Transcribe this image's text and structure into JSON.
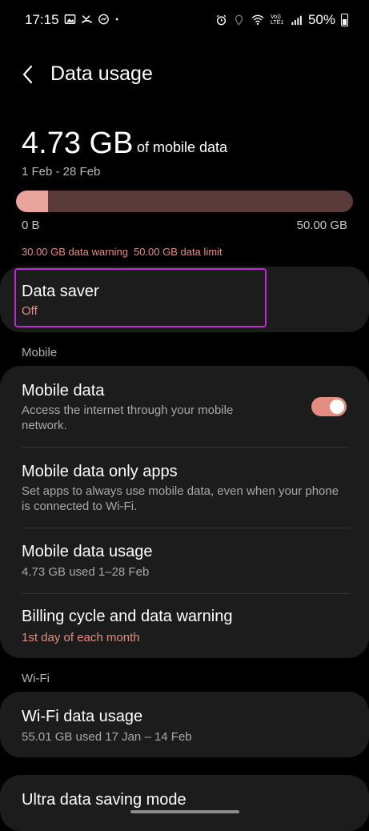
{
  "status_bar": {
    "time": "17:15",
    "left_icons": [
      "gallery-icon",
      "missed-call-icon",
      "messenger-icon",
      "dot-icon"
    ],
    "right_icons": [
      "alarm-icon",
      "location-icon",
      "wifi-icon",
      "volte-icon",
      "signal-icon"
    ],
    "volte_label": "Vo)) LTE1",
    "battery": "50%"
  },
  "header": {
    "title": "Data usage",
    "back_icon": "back-chevron-icon"
  },
  "usage": {
    "amount": "4.73 GB",
    "unit_label": "of mobile data",
    "period": "1 Feb - 28 Feb",
    "bar_fraction": 0.0946,
    "bar_min": "0 B",
    "bar_max": "50.00 GB",
    "warning_label": "30.00 GB data warning",
    "limit_label": "50.00 GB data limit"
  },
  "data_saver": {
    "title": "Data saver",
    "status": "Off"
  },
  "mobile_section": {
    "label": "Mobile",
    "items": [
      {
        "title": "Mobile data",
        "subtitle": "Access the internet through your mobile network.",
        "toggle_on": true
      },
      {
        "title": "Mobile data only apps",
        "subtitle": "Set apps to always use mobile data, even when your phone is connected to Wi-Fi."
      },
      {
        "title": "Mobile data usage",
        "subtitle": "4.73 GB used 1–28 Feb"
      },
      {
        "title": "Billing cycle and data warning",
        "subtitle": "1st day of each month"
      }
    ]
  },
  "wifi_section": {
    "label": "Wi-Fi",
    "items": [
      {
        "title": "Wi-Fi data usage",
        "subtitle": "55.01 GB used 17 Jan – 14 Feb"
      }
    ]
  },
  "more": {
    "title": "Ultra data saving mode"
  },
  "colors": {
    "accent": "#e58c80",
    "bar_track": "#5b3a3a",
    "bar_fill": "#e9a49c",
    "card_bg": "#1c1c1c",
    "highlight": "#c029d6"
  }
}
